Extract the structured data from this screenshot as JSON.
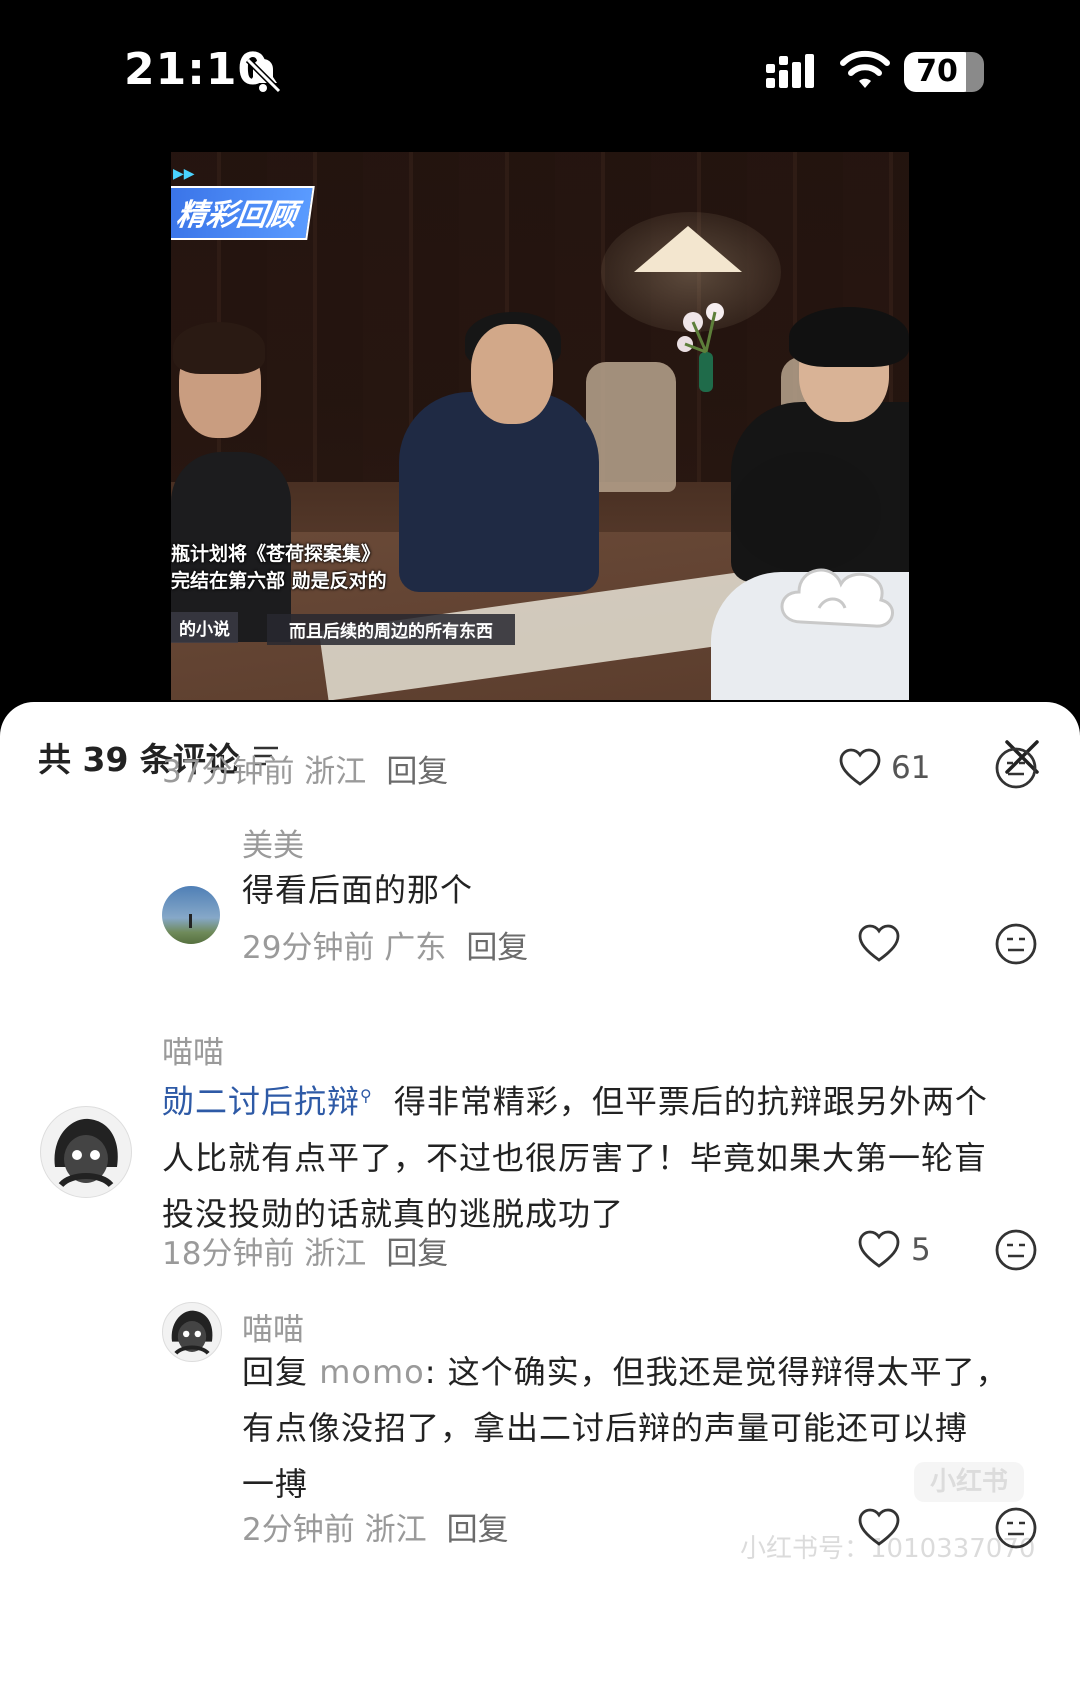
{
  "status_bar": {
    "time": "21:10",
    "battery": "70",
    "battery_level_pct": 70,
    "icons": [
      "bell-slash-icon",
      "cellular-signal-icon",
      "wifi-icon",
      "battery-icon"
    ]
  },
  "video": {
    "badge": "精彩回顾",
    "subtitle_line1": "瓶计划将《苍荷探案集》",
    "subtitle_line2": "完结在第六部  勋是反对的",
    "subtitle_tag": "的小说",
    "subtitle_line3": "而且后续的周边的所有东西"
  },
  "sheet": {
    "title": "共 39 条评论",
    "sort_icon": "sort-lines-icon",
    "close_icon": "close-icon"
  },
  "comments": [
    {
      "id": "c0",
      "meta": "37分钟前 浙江",
      "reply_label": "回复",
      "likes": "61"
    },
    {
      "id": "c1",
      "username": "美美",
      "text": "得看后面的那个",
      "meta": "29分钟前 广东",
      "reply_label": "回复",
      "likes": ""
    },
    {
      "id": "c2",
      "username": "喵喵",
      "topic": "勋二讨后抗辩",
      "text_line1": " 得非常精彩，但平票后的抗辩跟另外两个",
      "text_line2": "人比就有点平了，不过也很厉害了！毕竟如果大第一轮盲",
      "text_line3": "投没投勋的话就真的逃脱成功了",
      "meta": "18分钟前 浙江",
      "reply_label": "回复",
      "likes": "5"
    },
    {
      "id": "c3",
      "username": "喵喵",
      "reply_prefix": "回复 ",
      "mention": "momo",
      "text_line1": ": 这个确实，但我还是觉得辩得太平了，",
      "text_line2": "有点像没招了，拿出二讨后辩的声量可能还可以搏",
      "text_line3": "一搏",
      "meta": "2分钟前 浙江",
      "reply_label": "回复"
    }
  ],
  "watermark": {
    "logo": "小红书",
    "text": "小红书号：1010337070"
  },
  "colors": {
    "accent_link": "#2e5aa6",
    "meta_gray": "#9a9a9a",
    "text_dark": "#222222"
  }
}
